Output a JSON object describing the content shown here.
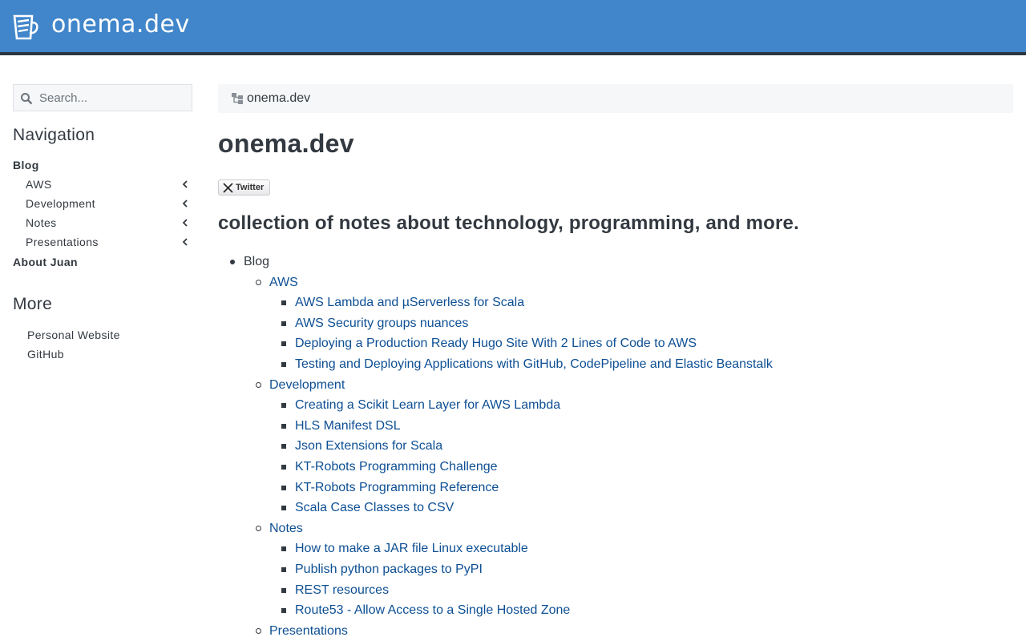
{
  "header": {
    "site_title": "onema.dev",
    "logo_icon": "coffee-cup-icon"
  },
  "colors": {
    "header_bg": "#4186ca",
    "header_border": "#2d3640",
    "link": "#0d4f94",
    "text": "#333940"
  },
  "search": {
    "placeholder": "Search...",
    "value": ""
  },
  "sidebar": {
    "nav_heading": "Navigation",
    "items": [
      {
        "label": "Blog"
      },
      {
        "label": "AWS"
      },
      {
        "label": "Development"
      },
      {
        "label": "Notes"
      },
      {
        "label": "Presentations"
      },
      {
        "label": "About Juan"
      }
    ],
    "more_heading": "More",
    "more_links": [
      {
        "label": "Personal Website"
      },
      {
        "label": "GitHub"
      }
    ]
  },
  "breadcrumb": {
    "label": "onema.dev"
  },
  "main": {
    "title": "onema.dev",
    "tweet_label": "Twitter",
    "subtitle": "collection of notes about technology, programming, and more.",
    "tree": {
      "root": "Blog",
      "sections": [
        {
          "label": "AWS",
          "posts": [
            "AWS Lambda and µServerless for Scala",
            "AWS Security groups nuances",
            "Deploying a Production Ready Hugo Site With 2 Lines of Code to AWS",
            "Testing and Deploying Applications with GitHub, CodePipeline and Elastic Beanstalk"
          ]
        },
        {
          "label": "Development",
          "posts": [
            "Creating a Scikit Learn Layer for AWS Lambda",
            "HLS Manifest DSL",
            "Json Extensions for Scala",
            "KT-Robots Programming Challenge",
            "KT-Robots Programming Reference",
            "Scala Case Classes to CSV"
          ]
        },
        {
          "label": "Notes",
          "posts": [
            "How to make a JAR file Linux executable",
            "Publish python packages to PyPI",
            "REST resources",
            "Route53 - Allow Access to a Single Hosted Zone"
          ]
        },
        {
          "label": "Presentations",
          "posts": []
        }
      ]
    }
  }
}
